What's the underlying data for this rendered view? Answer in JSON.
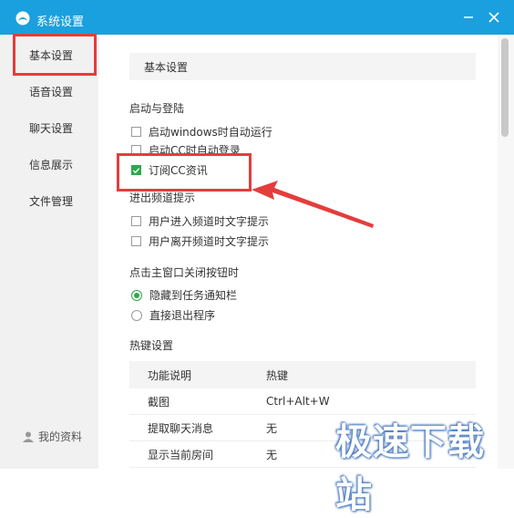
{
  "window": {
    "title": "系统设置",
    "accent_color": "#1aa0de"
  },
  "sidebar": {
    "items": [
      {
        "label": "基本设置",
        "selected": true
      },
      {
        "label": "语音设置"
      },
      {
        "label": "聊天设置"
      },
      {
        "label": "信息展示"
      },
      {
        "label": "文件管理"
      }
    ],
    "profile_label": "我的资料"
  },
  "content": {
    "section_title": "基本设置",
    "startup": {
      "title": "启动与登陆",
      "options": [
        {
          "label": "启动windows时自动运行",
          "checked": false
        },
        {
          "label": "启动CC时自动登录",
          "checked": false
        },
        {
          "label": "订阅CC资讯",
          "checked": true
        }
      ]
    },
    "channel": {
      "title": "进出频道提示",
      "options": [
        {
          "label": "用户进入频道时文字提示",
          "checked": false
        },
        {
          "label": "用户离开频道时文字提示",
          "checked": false
        }
      ]
    },
    "close_action": {
      "title": "点击主窗口关闭按钮时",
      "options": [
        {
          "label": "隐藏到任务通知栏",
          "checked": true
        },
        {
          "label": "直接退出程序",
          "checked": false
        }
      ]
    },
    "hotkeys": {
      "title": "热键设置",
      "headers": [
        "功能说明",
        "热键"
      ],
      "rows": [
        [
          "截图",
          "Ctrl+Alt+W"
        ],
        [
          "提取聊天消息",
          "无"
        ],
        [
          "显示当前房间",
          "无"
        ]
      ]
    }
  },
  "watermark": "极速下载站",
  "annotation_color": "#e43d3d"
}
